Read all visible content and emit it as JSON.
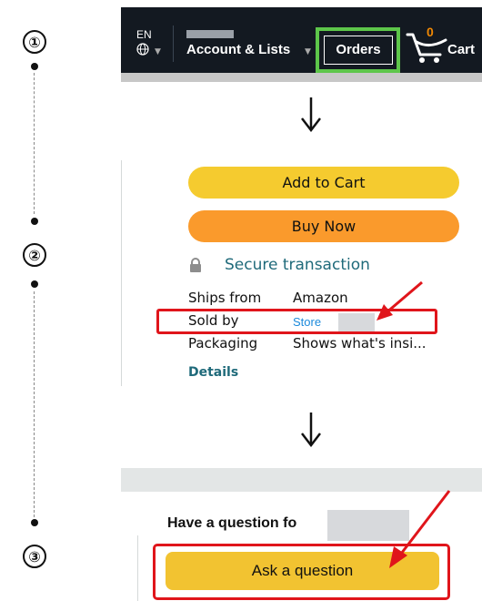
{
  "steps": [
    "①",
    "②",
    "③"
  ],
  "header": {
    "language": "EN",
    "account_label": "Account & Lists",
    "orders_label": "Orders",
    "cart_count": "0",
    "cart_label": "Cart",
    "background": "#131921",
    "highlight_color": "#5dc64a"
  },
  "buy_box": {
    "add_to_cart_label": "Add to Cart",
    "buy_now_label": "Buy Now",
    "secure_label": "Secure transaction",
    "rows": [
      {
        "label": "Ships from",
        "value": "Amazon"
      },
      {
        "label": "Sold by",
        "value": "Store"
      },
      {
        "label": "Packaging",
        "value": "Shows what's insi..."
      }
    ],
    "details_label": "Details",
    "add_to_cart_color": "#f5cb2f",
    "buy_now_color": "#fa9a2c",
    "link_color": "#1f6a7a"
  },
  "question": {
    "prompt": "Have a question fo",
    "button_label": "Ask a question",
    "button_color": "#f2c331"
  },
  "annotation_color": "#e0151b",
  "icons": [
    "globe-icon",
    "cart-icon",
    "lock-icon",
    "down-arrow-icon",
    "red-arrow-icon"
  ]
}
